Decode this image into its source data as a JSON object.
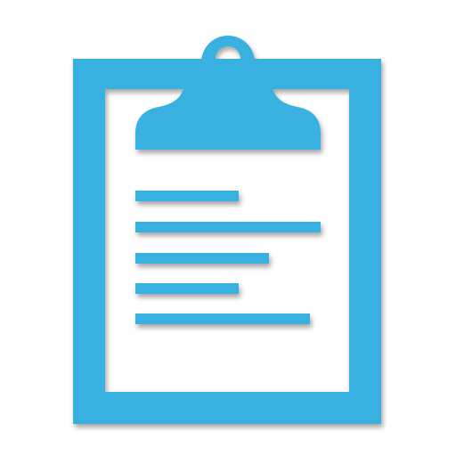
{
  "icon": {
    "name": "clipboard-icon",
    "color": "#38b0e0",
    "background": "#ffffff",
    "text_line_count": 5
  }
}
